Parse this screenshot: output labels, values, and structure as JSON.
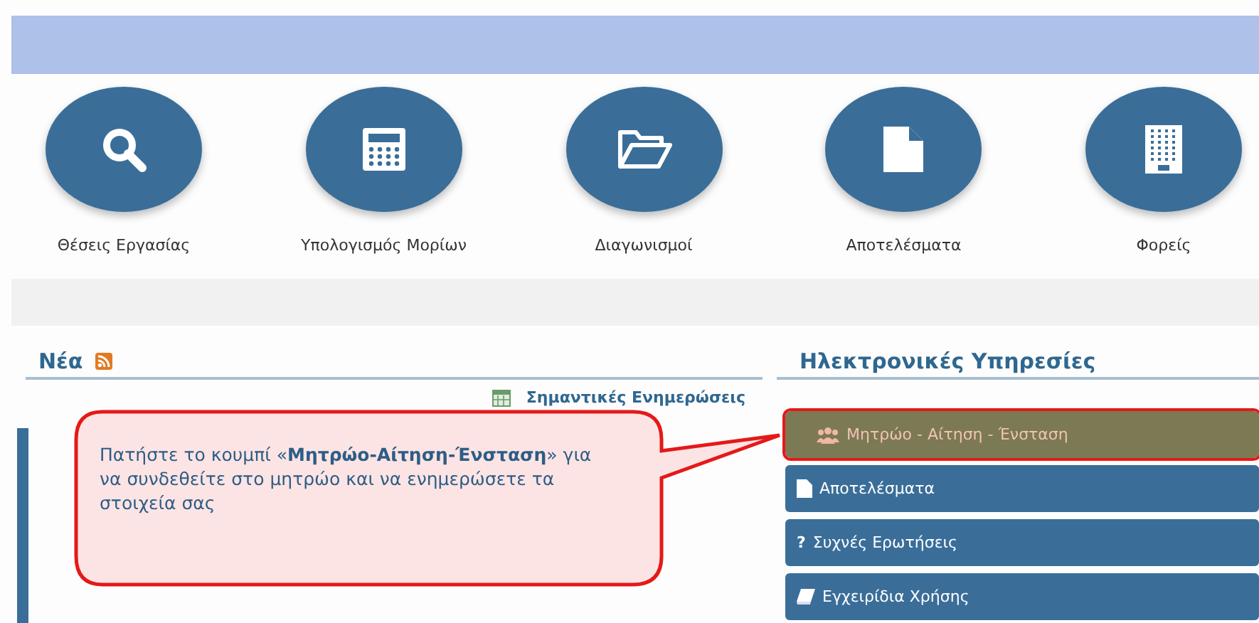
{
  "shortcuts": [
    {
      "kind": "search",
      "label": "Θέσεις Εργασίας"
    },
    {
      "kind": "calculator",
      "label": "Υπολογισμός Μορίων"
    },
    {
      "kind": "folder",
      "label": "Διαγωνισμοί"
    },
    {
      "kind": "document",
      "label": "Αποτελέσματα"
    },
    {
      "kind": "building",
      "label": "Φορείς"
    }
  ],
  "news": {
    "title": "Νέα",
    "link": "Σημαντικές Ενημερώσεις"
  },
  "services": {
    "title": "Ηλεκτρονικές Υπηρεσίες",
    "items": [
      {
        "kind": "people",
        "label": "Μητρώο - Αίτηση - Ένσταση",
        "highlighted": true
      },
      {
        "kind": "document",
        "label": "Αποτελέσματα",
        "highlighted": false
      },
      {
        "kind": "faq",
        "icon": "?",
        "label": "Συχνές Ερωτήσεις",
        "highlighted": false
      },
      {
        "kind": "book",
        "label": "Εγχειρίδια Χρήσης",
        "highlighted": false
      }
    ]
  },
  "callout": {
    "text": "Πατήστε το κουμπί «**Μητρώο-Αίτηση-Ένσταση**» για να συνδεθείτε στο μητρώο και να ενημερώσετε τα στοιχεία σας"
  }
}
